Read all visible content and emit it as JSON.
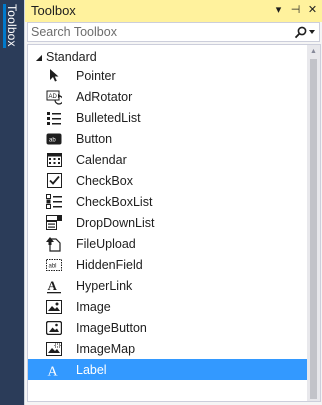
{
  "sidetab": {
    "label": "Toolbox"
  },
  "window": {
    "title": "Toolbox",
    "pin_glyph": "⊣",
    "close_glyph": "✕",
    "menu_glyph": "▾"
  },
  "search": {
    "placeholder": "Search Toolbox"
  },
  "tree": {
    "group": "Standard",
    "items": [
      {
        "label": "Pointer",
        "icon": "pointer-icon"
      },
      {
        "label": "AdRotator",
        "icon": "adrotator-icon"
      },
      {
        "label": "BulletedList",
        "icon": "bulletedlist-icon"
      },
      {
        "label": "Button",
        "icon": "button-icon"
      },
      {
        "label": "Calendar",
        "icon": "calendar-icon"
      },
      {
        "label": "CheckBox",
        "icon": "checkbox-icon"
      },
      {
        "label": "CheckBoxList",
        "icon": "checkboxlist-icon"
      },
      {
        "label": "DropDownList",
        "icon": "dropdownlist-icon"
      },
      {
        "label": "FileUpload",
        "icon": "fileupload-icon"
      },
      {
        "label": "HiddenField",
        "icon": "hiddenfield-icon"
      },
      {
        "label": "HyperLink",
        "icon": "hyperlink-icon"
      },
      {
        "label": "Image",
        "icon": "image-icon"
      },
      {
        "label": "ImageButton",
        "icon": "imagebutton-icon"
      },
      {
        "label": "ImageMap",
        "icon": "imagemap-icon"
      },
      {
        "label": "Label",
        "icon": "label-icon",
        "selected": true
      }
    ]
  },
  "colors": {
    "title_bg": "#fff29d",
    "selection": "#3399ff",
    "frame": "#2b3c59"
  }
}
